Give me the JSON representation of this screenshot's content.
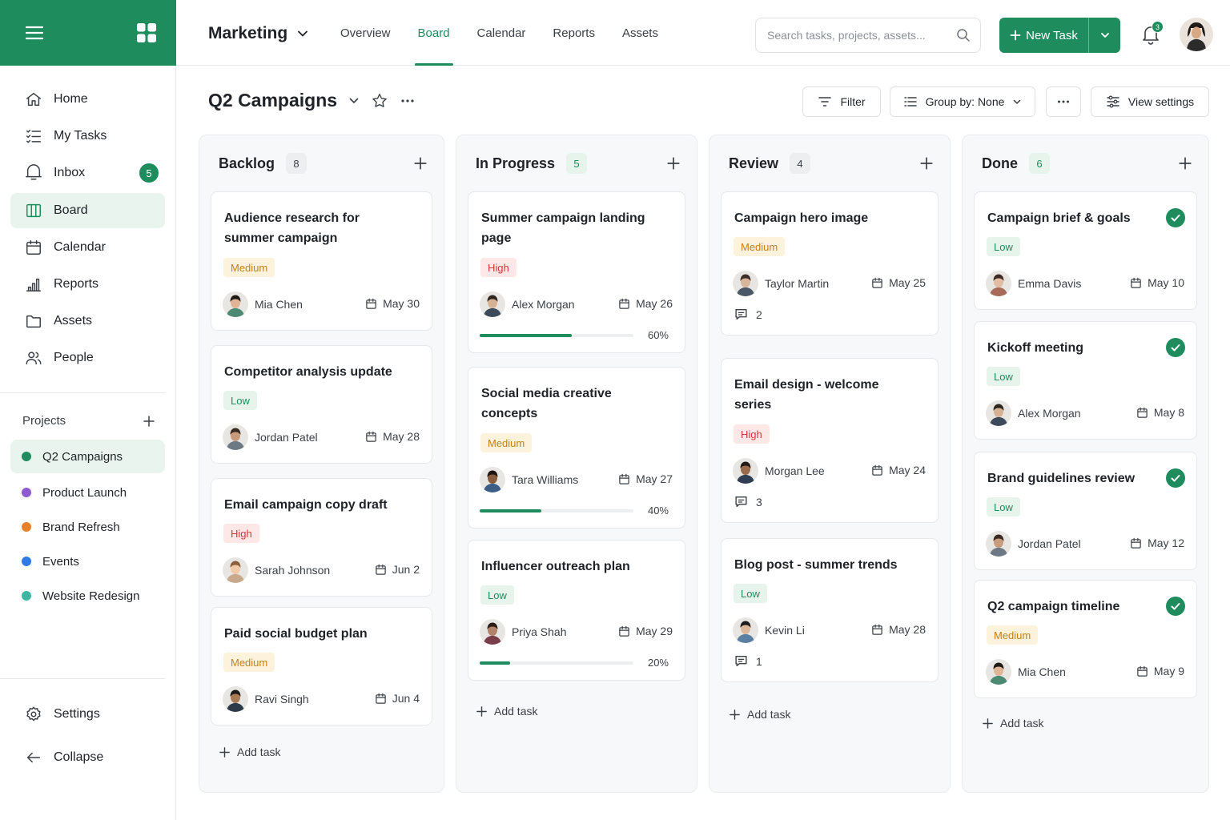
{
  "colors": {
    "accent": "#1e8c5c",
    "medium": "#c4801a",
    "high": "#d03a3a",
    "low": "#1e8c5c"
  },
  "icons": {
    "menu": "menu-icon",
    "logo": "grid-logo-icon",
    "search": "search-icon",
    "bell": "bell-icon",
    "plus": "plus-icon",
    "star": "star-icon",
    "calendar": "calendar-icon",
    "comment": "comment-icon",
    "check": "check-icon"
  },
  "sidebar": {
    "nav": [
      {
        "label": "Home"
      },
      {
        "label": "My Tasks"
      },
      {
        "label": "Inbox",
        "badge": "5"
      },
      {
        "label": "Board"
      },
      {
        "label": "Calendar"
      },
      {
        "label": "Reports"
      },
      {
        "label": "Assets"
      },
      {
        "label": "People"
      }
    ],
    "projects_label": "Projects",
    "projects": [
      {
        "label": "Q2 Campaigns",
        "color": "#1e8c5c"
      },
      {
        "label": "Product Launch",
        "color": "#8e5bd0"
      },
      {
        "label": "Brand Refresh",
        "color": "#e8822a"
      },
      {
        "label": "Events",
        "color": "#2f7be6"
      },
      {
        "label": "Website Redesign",
        "color": "#3bb8a4"
      }
    ],
    "settings": "Settings",
    "collapse": "Collapse"
  },
  "topbar": {
    "workspace": "Marketing",
    "tabs": [
      "Overview",
      "Board",
      "Calendar",
      "Reports",
      "Assets"
    ],
    "search_placeholder": "Search tasks, projects, assets...",
    "new_task": "New Task",
    "notifications": "3"
  },
  "page": {
    "title": "Q2 Campaigns",
    "filter": "Filter",
    "group_by": "Group by: None",
    "view_settings": "View settings"
  },
  "board": {
    "add_task": "Add task",
    "columns": [
      {
        "title": "Backlog",
        "count": "8",
        "cards": [
          {
            "title": "Audience research for summer campaign",
            "priority": "Medium",
            "assignee": "Mia Chen",
            "due": "May 30"
          },
          {
            "title": "Competitor analysis update",
            "priority": "Low",
            "assignee": "Jordan Patel",
            "due": "May 28"
          },
          {
            "title": "Email campaign copy draft",
            "priority": "High",
            "assignee": "Sarah Johnson",
            "due": "Jun 2"
          },
          {
            "title": "Paid social budget plan",
            "priority": "Medium",
            "assignee": "Ravi Singh",
            "due": "Jun 4"
          }
        ]
      },
      {
        "title": "In Progress",
        "count": "5",
        "cards": [
          {
            "title": "Summer campaign landing page",
            "priority": "High",
            "assignee": "Alex Morgan",
            "due": "May 26",
            "progress": "60%"
          },
          {
            "title": "Social media creative concepts",
            "priority": "Medium",
            "assignee": "Tara Williams",
            "due": "May 27",
            "progress": "40%"
          },
          {
            "title": "Influencer outreach plan",
            "priority": "Low",
            "assignee": "Priya Shah",
            "due": "May 29",
            "progress": "20%"
          }
        ]
      },
      {
        "title": "Review",
        "count": "4",
        "cards": [
          {
            "title": "Campaign hero image",
            "priority": "Medium",
            "assignee": "Taylor Martin",
            "due": "May 25",
            "comments": "2"
          },
          {
            "title": "Email design - welcome series",
            "priority": "High",
            "assignee": "Morgan Lee",
            "due": "May 24",
            "comments": "3"
          },
          {
            "title": "Blog post - summer trends",
            "priority": "Low",
            "assignee": "Kevin Li",
            "due": "May 28",
            "comments": "1"
          }
        ]
      },
      {
        "title": "Done",
        "count": "6",
        "cards": [
          {
            "title": "Campaign brief & goals",
            "priority": "Low",
            "assignee": "Emma Davis",
            "due": "May 10"
          },
          {
            "title": "Kickoff meeting",
            "priority": "Low",
            "assignee": "Alex Morgan",
            "due": "May 8"
          },
          {
            "title": "Brand guidelines review",
            "priority": "Low",
            "assignee": "Jordan Patel",
            "due": "May 12"
          },
          {
            "title": "Q2 campaign timeline",
            "priority": "Medium",
            "assignee": "Mia Chen",
            "due": "May 9"
          }
        ]
      }
    ]
  }
}
